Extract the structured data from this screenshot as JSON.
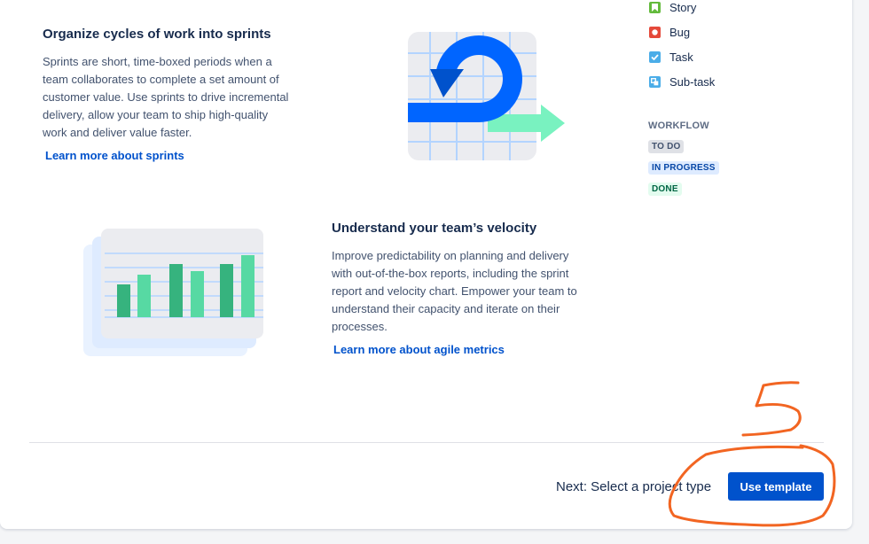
{
  "sprints": {
    "title": "Organize cycles of work into sprints",
    "description_lines": [
      "Sprints are short, time-boxed periods when a",
      "team collaborates to complete a set amount of",
      "customer value. Use sprints to drive incremental",
      "delivery, allow your team to ship high-quality",
      "work and deliver value faster."
    ],
    "link": "Learn more about sprints"
  },
  "velocity": {
    "title": "Understand your team’s velocity",
    "description_lines": [
      "Improve predictability on planning and delivery",
      "with out-of-the-box reports, including the sprint",
      "report and velocity chart. Empower your team to",
      "understand their capacity and iterate on their",
      "processes."
    ],
    "link": "Learn more about agile metrics"
  },
  "issue_types": [
    {
      "label": "Story",
      "icon": "story-icon",
      "color": "#63ba3c"
    },
    {
      "label": "Bug",
      "icon": "bug-icon",
      "color": "#e5493a"
    },
    {
      "label": "Task",
      "icon": "task-icon",
      "color": "#4bade8"
    },
    {
      "label": "Sub-task",
      "icon": "subtask-icon",
      "color": "#4bade8"
    }
  ],
  "workflow": {
    "heading": "WORKFLOW",
    "statuses": [
      {
        "label": "TO DO",
        "bg": "#dfe1e6",
        "color": "#42526e"
      },
      {
        "label": "IN PROGRESS",
        "bg": "#deebff",
        "color": "#0747a6"
      },
      {
        "label": "DONE",
        "bg": "#e3fcef",
        "color": "#006644"
      }
    ]
  },
  "footer": {
    "next_text": "Next: Select a project type",
    "button_label": "Use template"
  },
  "annotation": {
    "text": "5",
    "color": "#f26522"
  },
  "colors": {
    "primary": "#0052cc",
    "text": "#172b4d",
    "subtle_text": "#42526e",
    "green": "#36b37e",
    "light_green": "#57d9a3"
  }
}
